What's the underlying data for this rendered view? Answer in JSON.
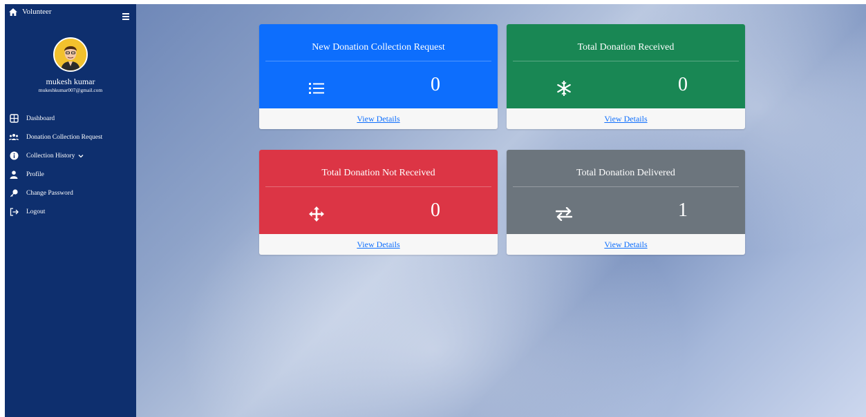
{
  "sidebar": {
    "brand": "Volunteer",
    "user_name": "mukesh kumar",
    "user_email": "mukeshkumar007@gmail.com",
    "items": [
      {
        "label": "Dashboard",
        "icon": "dashboard-icon"
      },
      {
        "label": "Donation Collection Request",
        "icon": "users-icon"
      },
      {
        "label": "Collection History",
        "icon": "info-icon"
      },
      {
        "label": "Profile",
        "icon": "user-icon"
      },
      {
        "label": "Change Password",
        "icon": "key-icon"
      },
      {
        "label": "Logout",
        "icon": "logout-icon"
      }
    ]
  },
  "cards": [
    {
      "title": "New Donation Collection Request",
      "count": "0",
      "link": "View Details",
      "color": "#0d6efd",
      "icon": "list-icon"
    },
    {
      "title": "Total Donation Received",
      "count": "0",
      "link": "View Details",
      "color": "#198754",
      "icon": "snowflake-icon"
    },
    {
      "title": "Total Donation Not Received",
      "count": "0",
      "link": "View Details",
      "color": "#dc3545",
      "icon": "arrows-move-icon"
    },
    {
      "title": "Total Donation Delivered",
      "count": "1",
      "link": "View Details",
      "color": "#6c757d",
      "icon": "exchange-icon"
    }
  ]
}
